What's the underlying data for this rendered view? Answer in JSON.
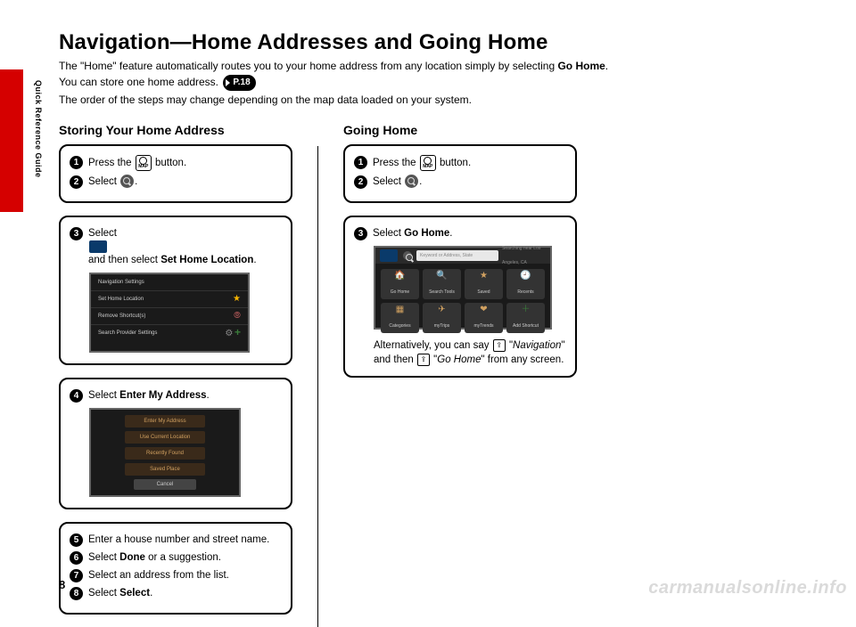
{
  "side_label": "Quick Reference Guide",
  "page_number": "8",
  "watermark": "carmanualsonline.info",
  "title": "Navigation—Home Addresses and Going Home",
  "intro": {
    "line1_a": "The \"Home\" feature automatically routes you to your home address from any location simply by selecting ",
    "line1_b": "Go Home",
    "line1_c": ".",
    "line2": "You can store one home address.",
    "pref": "P.18",
    "line3": "The order of the steps may change depending on the map data loaded on your system."
  },
  "icons": {
    "map_label": "MAP",
    "talk": "⇪"
  },
  "colA": {
    "heading": "Storing Your Home Address",
    "box1": {
      "s1a": "Press the ",
      "s1b": " button.",
      "s2a": "Select ",
      "s2b": "."
    },
    "box2": {
      "s3a": "Select ",
      "s3b": " and then select ",
      "s3c": "Set Home Location",
      "s3d": ".",
      "ss_rows": [
        {
          "l": "Navigation Settings",
          "r": "",
          "cls": ""
        },
        {
          "l": "Set Home Location",
          "r": "star"
        },
        {
          "l": "Remove Shortcut(s)",
          "r": "clock"
        },
        {
          "l": "Search Provider Settings",
          "r": "plus"
        }
      ]
    },
    "box3": {
      "s4a": "Select ",
      "s4b": "Enter My Address",
      "s4c": ".",
      "ss_items": [
        "Enter My Address",
        "Use Current Location",
        "Recently Found",
        "Saved Place"
      ],
      "ss_cancel": "Cancel"
    },
    "box4": {
      "s5": "Enter a house number and street name.",
      "s6a": "Select ",
      "s6b": "Done",
      "s6c": " or a suggestion.",
      "s7": "Select an address from the list.",
      "s8a": "Select ",
      "s8b": "Select",
      "s8c": "."
    }
  },
  "colB": {
    "heading": "Going Home",
    "box1": {
      "s1a": "Press the ",
      "s1b": " button.",
      "s2a": "Select ",
      "s2b": "."
    },
    "box2": {
      "s3a": "Select ",
      "s3b": "Go Home",
      "s3c": ".",
      "ss_search": "Keyword or Address, State",
      "ss_loc": "Searching near\nLos Angeles, CA",
      "tiles": [
        {
          "ico": "🏠",
          "label": "Go Home"
        },
        {
          "ico": "🔍",
          "label": "Search Tools"
        },
        {
          "ico": "★",
          "label": "Saved"
        },
        {
          "ico": "🕘",
          "label": "Recents"
        },
        {
          "ico": "▦",
          "label": "Categories"
        },
        {
          "ico": "✈",
          "label": "myTrips"
        },
        {
          "ico": "❤",
          "label": "myTrends"
        },
        {
          "ico": "＋",
          "label": "Add Shortcut"
        }
      ],
      "alt1": "Alternatively, you can say ",
      "alt2": " \"",
      "alt2i": "Navigation",
      "alt3": "\" and then ",
      "alt4": " \"",
      "alt4i": "Go Home",
      "alt5": "\" from any screen."
    }
  }
}
